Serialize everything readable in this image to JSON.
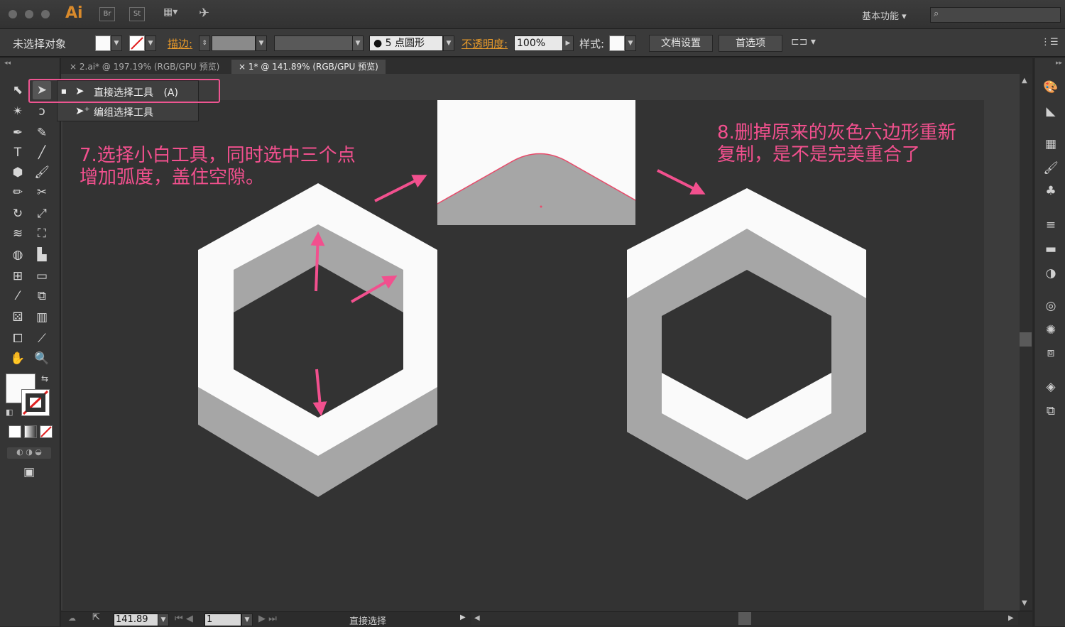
{
  "app": {
    "logo": "Ai",
    "bridge": "Br",
    "stock": "St",
    "workspace": "基本功能"
  },
  "control": {
    "no_selection": "未选择对象",
    "stroke_label": "描边:",
    "brush": "5 点圆形",
    "opacity_label": "不透明度:",
    "opacity_value": "100%",
    "style_label": "样式:",
    "doc_setup": "文档设置",
    "preferences": "首选项"
  },
  "tabs": [
    {
      "label": "2.ai* @ 197.19% (RGB/GPU 预览)"
    },
    {
      "label": "1* @ 141.89% (RGB/GPU 预览)"
    }
  ],
  "flyout": {
    "items": [
      {
        "label": "直接选择工具",
        "shortcut": "(A)"
      },
      {
        "label": "编组选择工具"
      }
    ]
  },
  "annotations": {
    "step7_line1": "7.选择小白工具，同时选中三个点",
    "step7_line2": "增加弧度，盖住空隙。",
    "step8_line1": "8.删掉原来的灰色六边形重新",
    "step8_line2": "复制，是不是完美重合了"
  },
  "status": {
    "zoom": "141.89",
    "page": "1",
    "tool": "直接选择"
  },
  "colors": {
    "annotation": "#f2508e",
    "hex_white": "#fafafa",
    "hex_gray": "#a6a6a6",
    "artboard": "#333333"
  }
}
